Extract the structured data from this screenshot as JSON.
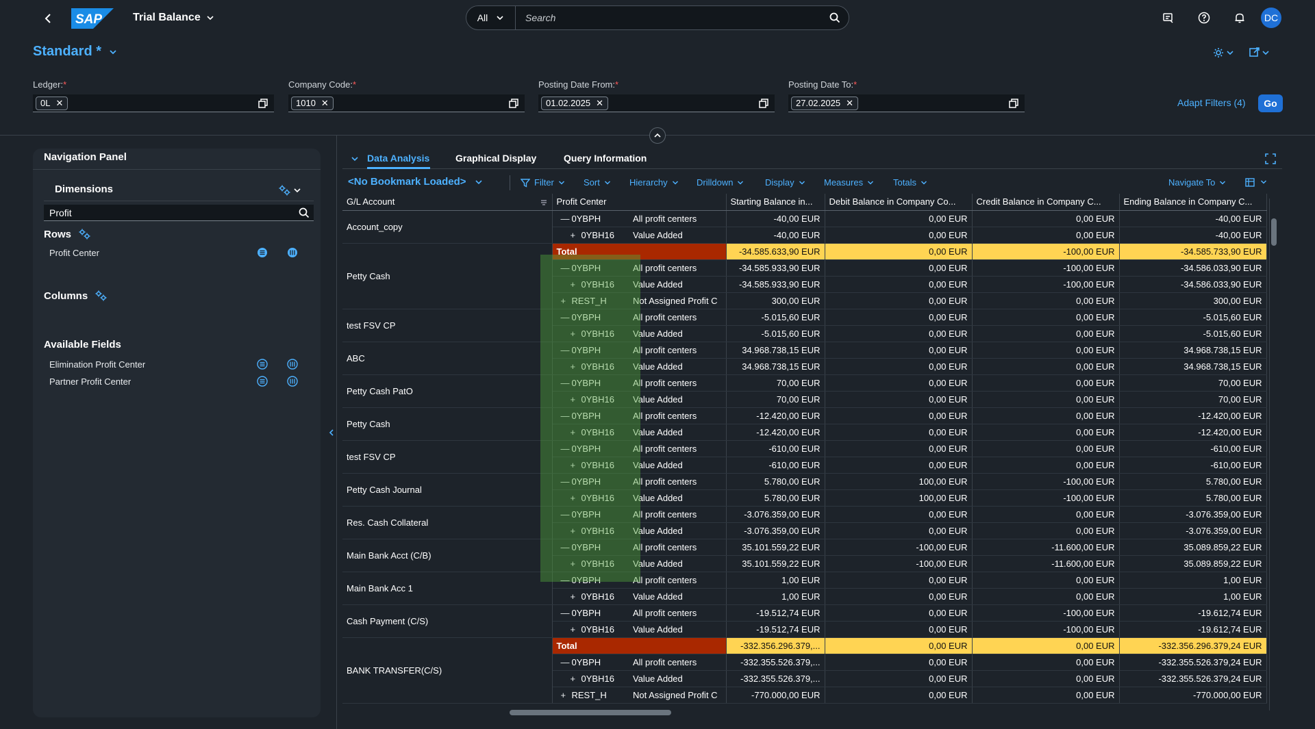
{
  "shell": {
    "app_title": "Trial Balance",
    "logo_text": "SAP",
    "search_scope": "All",
    "search_placeholder": "Search",
    "avatar_initials": "DC"
  },
  "header": {
    "variant": "Standard *",
    "adapt_filters": "Adapt Filters (4)",
    "go": "Go",
    "filters": [
      {
        "label": "Ledger:",
        "value": "0L"
      },
      {
        "label": "Company Code:",
        "value": "1010"
      },
      {
        "label": "Posting Date From:",
        "value": "01.02.2025"
      },
      {
        "label": "Posting Date To:",
        "value": "27.02.2025"
      }
    ]
  },
  "nav": {
    "title": "Navigation Panel",
    "dimensions": "Dimensions",
    "search_value": "Profit",
    "rows_title": "Rows",
    "rows_items": [
      "Profit Center"
    ],
    "columns_title": "Columns",
    "available_title": "Available Fields",
    "available_items": [
      "Elimination Profit Center",
      "Partner Profit Center"
    ]
  },
  "tabs": [
    "Data Analysis",
    "Graphical Display",
    "Query Information"
  ],
  "toolbar": {
    "bookmark": "<No Bookmark Loaded>",
    "buttons": [
      "Filter",
      "Sort",
      "Hierarchy",
      "Drilldown",
      "Display",
      "Measures",
      "Totals"
    ],
    "navigate": "Navigate To"
  },
  "table": {
    "headers": [
      "G/L Account",
      "Profit Center",
      "Starting Balance in...",
      "Debit Balance in Company Co...",
      "Credit Balance in Company C...",
      "Ending Balance in Company C..."
    ],
    "groups": [
      {
        "account": "Account_copy",
        "rows": [
          {
            "type": "row",
            "sym": "—",
            "code": "0YBPH",
            "name": "All profit centers",
            "v": [
              "-40,00 EUR",
              "0,00 EUR",
              "0,00 EUR",
              "-40,00 EUR"
            ]
          },
          {
            "type": "row",
            "sym": "+",
            "code": "0YBH16",
            "name": "Value Added",
            "v": [
              "-40,00 EUR",
              "0,00 EUR",
              "0,00 EUR",
              "-40,00 EUR"
            ]
          }
        ]
      },
      {
        "account": "Petty Cash",
        "rows": [
          {
            "type": "total",
            "label": "Total",
            "v": [
              "-34.585.633,90 EUR",
              "0,00 EUR",
              "-100,00 EUR",
              "-34.585.733,90 EUR"
            ]
          },
          {
            "type": "row",
            "sym": "—",
            "code": "0YBPH",
            "name": "All profit centers",
            "v": [
              "-34.585.933,90 EUR",
              "0,00 EUR",
              "-100,00 EUR",
              "-34.586.033,90 EUR"
            ]
          },
          {
            "type": "row",
            "sym": "+",
            "code": "0YBH16",
            "name": "Value Added",
            "v": [
              "-34.585.933,90 EUR",
              "0,00 EUR",
              "-100,00 EUR",
              "-34.586.033,90 EUR"
            ]
          },
          {
            "type": "row",
            "sym": "+",
            "code": "REST_H",
            "name": "Not Assigned Profit C",
            "v": [
              "300,00 EUR",
              "0,00 EUR",
              "0,00 EUR",
              "300,00 EUR"
            ]
          }
        ]
      },
      {
        "account": "test FSV CP",
        "rows": [
          {
            "type": "row",
            "sym": "—",
            "code": "0YBPH",
            "name": "All profit centers",
            "v": [
              "-5.015,60 EUR",
              "0,00 EUR",
              "0,00 EUR",
              "-5.015,60 EUR"
            ]
          },
          {
            "type": "row",
            "sym": "+",
            "code": "0YBH16",
            "name": "Value Added",
            "v": [
              "-5.015,60 EUR",
              "0,00 EUR",
              "0,00 EUR",
              "-5.015,60 EUR"
            ]
          }
        ]
      },
      {
        "account": "ABC",
        "rows": [
          {
            "type": "row",
            "sym": "—",
            "code": "0YBPH",
            "name": "All profit centers",
            "v": [
              "34.968.738,15 EUR",
              "0,00 EUR",
              "0,00 EUR",
              "34.968.738,15 EUR"
            ]
          },
          {
            "type": "row",
            "sym": "+",
            "code": "0YBH16",
            "name": "Value Added",
            "v": [
              "34.968.738,15 EUR",
              "0,00 EUR",
              "0,00 EUR",
              "34.968.738,15 EUR"
            ]
          }
        ]
      },
      {
        "account": "Petty Cash PatO",
        "rows": [
          {
            "type": "row",
            "sym": "—",
            "code": "0YBPH",
            "name": "All profit centers",
            "v": [
              "70,00 EUR",
              "0,00 EUR",
              "0,00 EUR",
              "70,00 EUR"
            ]
          },
          {
            "type": "row",
            "sym": "+",
            "code": "0YBH16",
            "name": "Value Added",
            "v": [
              "70,00 EUR",
              "0,00 EUR",
              "0,00 EUR",
              "70,00 EUR"
            ]
          }
        ]
      },
      {
        "account": "Petty Cash",
        "rows": [
          {
            "type": "row",
            "sym": "—",
            "code": "0YBPH",
            "name": "All profit centers",
            "v": [
              "-12.420,00 EUR",
              "0,00 EUR",
              "0,00 EUR",
              "-12.420,00 EUR"
            ]
          },
          {
            "type": "row",
            "sym": "+",
            "code": "0YBH16",
            "name": "Value Added",
            "v": [
              "-12.420,00 EUR",
              "0,00 EUR",
              "0,00 EUR",
              "-12.420,00 EUR"
            ]
          }
        ]
      },
      {
        "account": "test FSV CP",
        "rows": [
          {
            "type": "row",
            "sym": "—",
            "code": "0YBPH",
            "name": "All profit centers",
            "v": [
              "-610,00 EUR",
              "0,00 EUR",
              "0,00 EUR",
              "-610,00 EUR"
            ]
          },
          {
            "type": "row",
            "sym": "+",
            "code": "0YBH16",
            "name": "Value Added",
            "v": [
              "-610,00 EUR",
              "0,00 EUR",
              "0,00 EUR",
              "-610,00 EUR"
            ]
          }
        ]
      },
      {
        "account": "Petty Cash Journal",
        "rows": [
          {
            "type": "row",
            "sym": "—",
            "code": "0YBPH",
            "name": "All profit centers",
            "v": [
              "5.780,00 EUR",
              "100,00 EUR",
              "-100,00 EUR",
              "5.780,00 EUR"
            ]
          },
          {
            "type": "row",
            "sym": "+",
            "code": "0YBH16",
            "name": "Value Added",
            "v": [
              "5.780,00 EUR",
              "100,00 EUR",
              "-100,00 EUR",
              "5.780,00 EUR"
            ]
          }
        ]
      },
      {
        "account": "Res. Cash Collateral",
        "rows": [
          {
            "type": "row",
            "sym": "—",
            "code": "0YBPH",
            "name": "All profit centers",
            "v": [
              "-3.076.359,00 EUR",
              "0,00 EUR",
              "0,00 EUR",
              "-3.076.359,00 EUR"
            ]
          },
          {
            "type": "row",
            "sym": "+",
            "code": "0YBH16",
            "name": "Value Added",
            "v": [
              "-3.076.359,00 EUR",
              "0,00 EUR",
              "0,00 EUR",
              "-3.076.359,00 EUR"
            ]
          }
        ]
      },
      {
        "account": "Main Bank Acct (C/B)",
        "rows": [
          {
            "type": "row",
            "sym": "—",
            "code": "0YBPH",
            "name": "All profit centers",
            "v": [
              "35.101.559,22 EUR",
              "-100,00 EUR",
              "-11.600,00 EUR",
              "35.089.859,22 EUR"
            ]
          },
          {
            "type": "row",
            "sym": "+",
            "code": "0YBH16",
            "name": "Value Added",
            "v": [
              "35.101.559,22 EUR",
              "-100,00 EUR",
              "-11.600,00 EUR",
              "35.089.859,22 EUR"
            ]
          }
        ]
      },
      {
        "account": "Main Bank Acc 1",
        "rows": [
          {
            "type": "row",
            "sym": "—",
            "code": "0YBPH",
            "name": "All profit centers",
            "v": [
              "1,00 EUR",
              "0,00 EUR",
              "0,00 EUR",
              "1,00 EUR"
            ]
          },
          {
            "type": "row",
            "sym": "+",
            "code": "0YBH16",
            "name": "Value Added",
            "v": [
              "1,00 EUR",
              "0,00 EUR",
              "0,00 EUR",
              "1,00 EUR"
            ]
          }
        ]
      },
      {
        "account": "Cash Payment (C/S)",
        "rows": [
          {
            "type": "row",
            "sym": "—",
            "code": "0YBPH",
            "name": "All profit centers",
            "v": [
              "-19.512,74 EUR",
              "0,00 EUR",
              "-100,00 EUR",
              "-19.612,74 EUR"
            ]
          },
          {
            "type": "row",
            "sym": "+",
            "code": "0YBH16",
            "name": "Value Added",
            "v": [
              "-19.512,74 EUR",
              "0,00 EUR",
              "-100,00 EUR",
              "-19.612,74 EUR"
            ]
          }
        ]
      },
      {
        "account": "BANK TRANSFER(C/S)",
        "rows": [
          {
            "type": "total",
            "label": "Total",
            "v": [
              "-332.356.296.379,...",
              "0,00 EUR",
              "0,00 EUR",
              "-332.356.296.379,24 EUR"
            ]
          },
          {
            "type": "row",
            "sym": "—",
            "code": "0YBPH",
            "name": "All profit centers",
            "v": [
              "-332.355.526.379,...",
              "0,00 EUR",
              "0,00 EUR",
              "-332.355.526.379,24 EUR"
            ]
          },
          {
            "type": "row",
            "sym": "+",
            "code": "0YBH16",
            "name": "Value Added",
            "v": [
              "-332.355.526.379,...",
              "0,00 EUR",
              "0,00 EUR",
              "-332.355.526.379,24 EUR"
            ]
          },
          {
            "type": "row",
            "sym": "+",
            "code": "REST_H",
            "name": "Not Assigned Profit C",
            "v": [
              "-770.000,00 EUR",
              "0,00 EUR",
              "0,00 EUR",
              "-770.000,00 EUR"
            ]
          }
        ]
      }
    ]
  }
}
